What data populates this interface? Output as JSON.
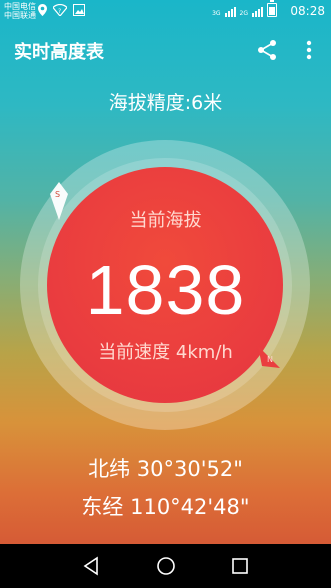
{
  "status_bar": {
    "carrier_1": "中国电信",
    "carrier_2": "中国联通",
    "net_type_1": "3G",
    "net_type_2": "2G",
    "time": "08:28"
  },
  "app_bar": {
    "title": "实时高度表",
    "share_icon": "share-icon",
    "more_icon": "more-vert-icon"
  },
  "accuracy_text": "海拔精度:6米",
  "dial": {
    "altitude_label": "当前海拔",
    "altitude_value": "1838",
    "speed_text": "当前速度 4km/h",
    "south_marker": "S",
    "north_marker": "N"
  },
  "coordinates": {
    "latitude": "北纬 30°30'52\"",
    "longitude": "东经 110°42'48\""
  },
  "nav_bar": {
    "back_icon": "back-triangle-icon",
    "home_icon": "home-circle-icon",
    "recents_icon": "recents-square-icon"
  },
  "colors": {
    "dial_inner": "#ea3d3f",
    "gradient_top": "#1ab6c9",
    "gradient_bottom": "#d04a35"
  }
}
